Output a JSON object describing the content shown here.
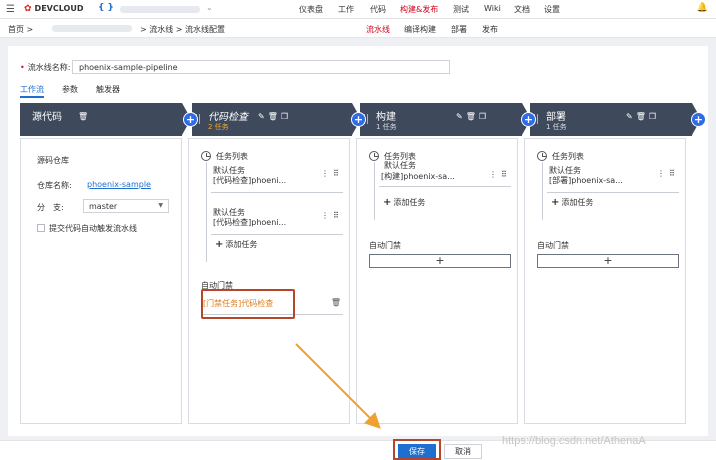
{
  "topbar": {
    "logo_text": "DEVCLOUD",
    "project_braces": "{ }",
    "nav": [
      "仪表盘",
      "工作",
      "代码",
      "构建&发布",
      "测试",
      "Wiki",
      "文档",
      "设置"
    ],
    "active_nav": "构建&发布"
  },
  "breadcrumb": {
    "home": "首页 >",
    "tail": "> 流水线 > 流水线配置"
  },
  "subtabs": [
    "流水线",
    "编译构建",
    "部署",
    "发布"
  ],
  "active_subtab": "流水线",
  "pipeline_name": {
    "label": "流水线名称:",
    "value": "phoenix-sample-pipeline"
  },
  "tabs": [
    "工作流",
    "参数",
    "触发器"
  ],
  "active_tab": "工作流",
  "stages": [
    {
      "title": "源代码",
      "count": ""
    },
    {
      "title": "代码检查",
      "count": "2 任务"
    },
    {
      "title": "构建",
      "count": "1 任务"
    },
    {
      "title": "部署",
      "count": "1 任务"
    }
  ],
  "source": {
    "title": "源码仓库",
    "repo_label": "仓库名称:",
    "repo_value": "phoenix-sample",
    "branch_label": "分　支:",
    "branch_value": "master",
    "trigger_label": "提交代码自动触发流水线"
  },
  "code_check": {
    "list_title": "任务列表",
    "tasks": [
      {
        "title": "默认任务",
        "sub": "[代码检查]phoeni..."
      },
      {
        "title": "默认任务",
        "sub": "[代码检查]phoeni..."
      }
    ],
    "add_task": "添加任务",
    "gate_label": "自动门禁",
    "gate_item": "[门禁任务]代码检查"
  },
  "build": {
    "list_title": "任务列表",
    "tasks": [
      {
        "title": "默认任务",
        "sub": "[构建]phoenix-sa..."
      }
    ],
    "add_task": "添加任务",
    "gate_label": "自动门禁"
  },
  "deploy": {
    "list_title": "任务列表",
    "tasks": [
      {
        "title": "默认任务",
        "sub": "[部署]phoenix-sa..."
      }
    ],
    "add_task": "添加任务",
    "gate_label": "自动门禁"
  },
  "footer": {
    "save": "保存",
    "cancel": "取消",
    "watermark": "https://blog.csdn.net/AthenaA"
  },
  "colors": {
    "brand_red": "#d0021b",
    "primary_blue": "#1f6fd1",
    "stage_bg": "#3e4a5c",
    "accent_orange": "#f5a623",
    "highlight": "#b5462a"
  }
}
